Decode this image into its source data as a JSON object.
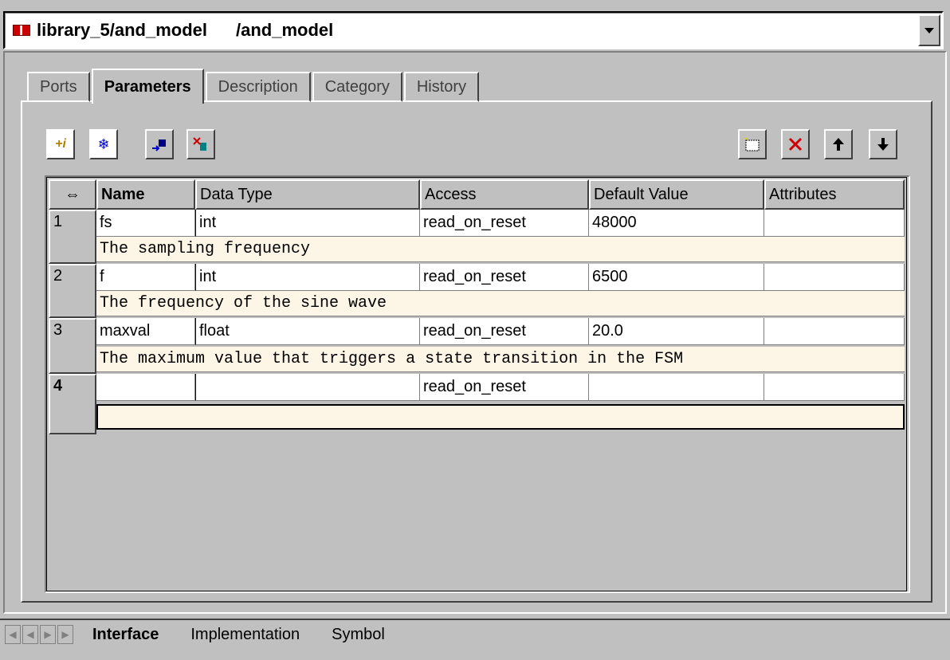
{
  "window": {
    "title": "library_5/and_model",
    "subtitle": "/and_model"
  },
  "tabs": [
    {
      "label": "Ports"
    },
    {
      "label": "Parameters"
    },
    {
      "label": "Description"
    },
    {
      "label": "Category"
    },
    {
      "label": "History"
    }
  ],
  "toolbar": {
    "info_icon": "+i",
    "freeze_icon": "❄"
  },
  "table": {
    "columns": [
      "⇔",
      "Name",
      "Data Type",
      "Access",
      "Default Value",
      "Attributes"
    ],
    "rows": [
      {
        "num": "1",
        "name": "fs",
        "type": "int",
        "access": "read_on_reset",
        "default": "48000",
        "attributes": "",
        "description": "The sampling frequency"
      },
      {
        "num": "2",
        "name": "f",
        "type": "int",
        "access": "read_on_reset",
        "default": "6500",
        "attributes": "",
        "description": "The frequency of the sine wave"
      },
      {
        "num": "3",
        "name": "maxval",
        "type": "float",
        "access": "read_on_reset",
        "default": "20.0",
        "attributes": "",
        "description": "The maximum value that triggers a state transition in the FSM"
      },
      {
        "num": "4",
        "name": "",
        "type": "",
        "access": "read_on_reset",
        "default": "",
        "attributes": "",
        "description": ""
      }
    ]
  },
  "bottom_tabs": [
    {
      "label": "Interface"
    },
    {
      "label": "Implementation"
    },
    {
      "label": "Symbol"
    }
  ]
}
